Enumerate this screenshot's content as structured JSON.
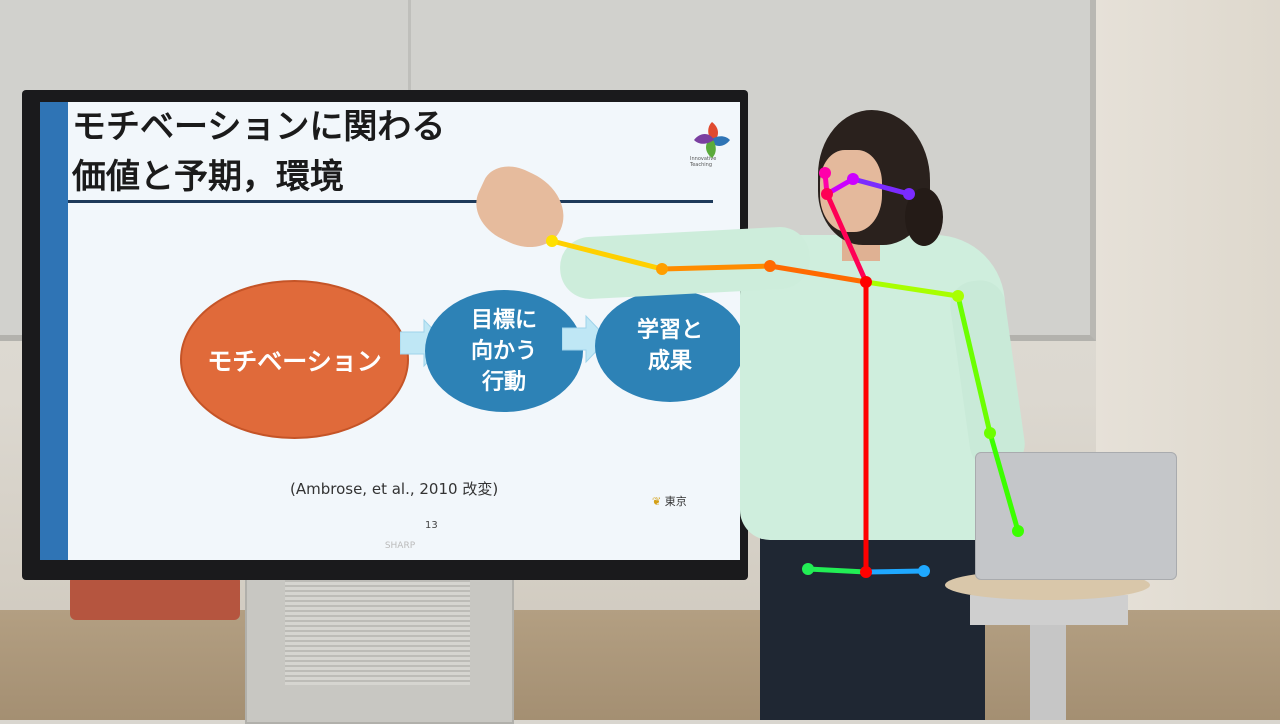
{
  "slide": {
    "title_line1": "モチベーションに関わる",
    "title_line2": "価値と予期，環境",
    "node1": "モチベーション",
    "node2": "目標に\n向かう\n行動",
    "node3": "学習と\n成果",
    "citation": "(Ambrose, et al., 2010 改変)",
    "page_number": "13",
    "logo_caption": "Innovative Teaching",
    "university_mark": "東京"
  },
  "tv": {
    "brand": "SHARP"
  },
  "colors": {
    "node1": "#e06a3a",
    "node_blue": "#2d82b6",
    "arrow": "#bfe7f5",
    "slide_stripe": "#2f74b5"
  },
  "pose_overlay": {
    "description_colors": [
      "#ff0000",
      "#ff6a00",
      "#ffd000",
      "#a8ff00",
      "#3cff00",
      "#1fa8ff",
      "#ff00aa",
      "#8a2be2"
    ]
  }
}
